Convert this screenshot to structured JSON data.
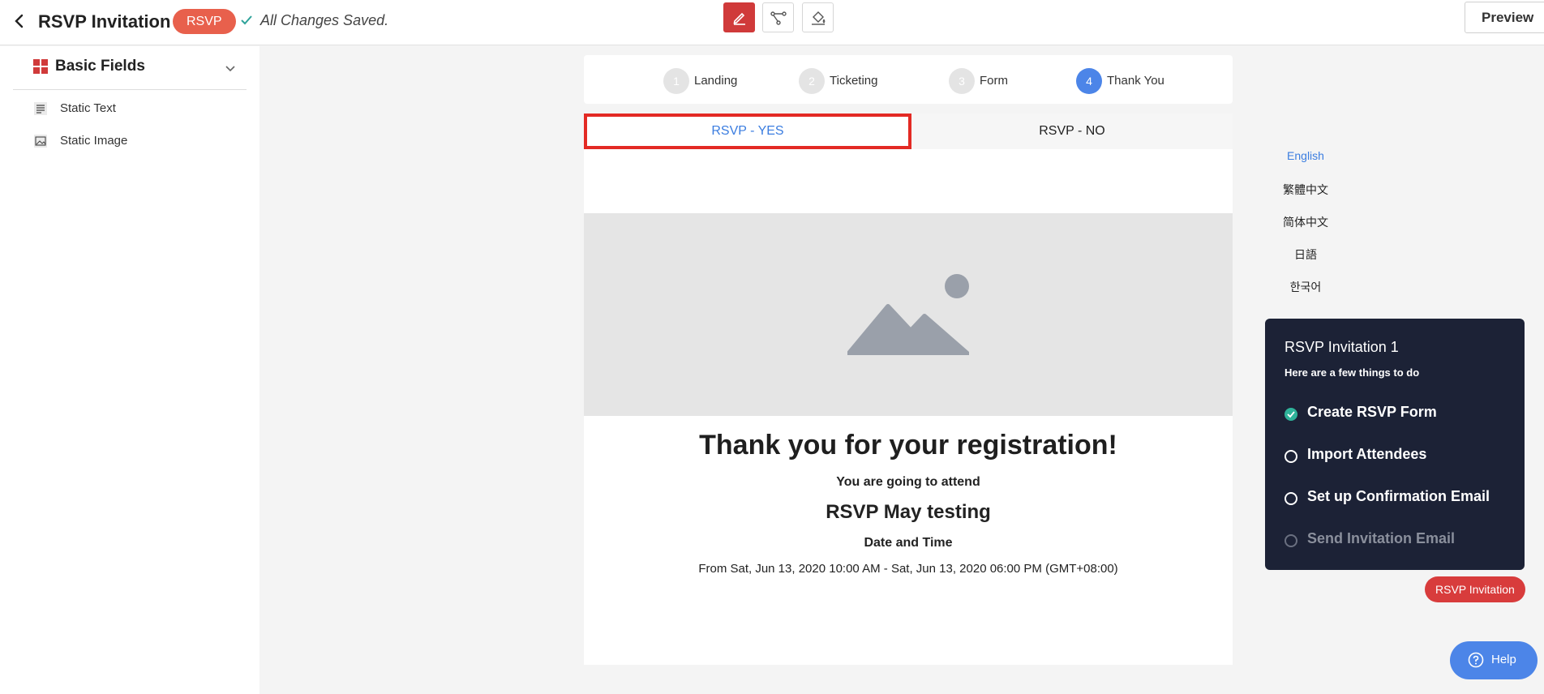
{
  "header": {
    "title": "RSVP Invitation 1",
    "badge": "RSVP",
    "saved_status": "All Changes Saved.",
    "preview_label": "Preview"
  },
  "sidebar": {
    "section_title": "Basic Fields",
    "items": [
      {
        "label": "Static Text",
        "icon": "text-lines-icon"
      },
      {
        "label": "Static Image",
        "icon": "image-icon"
      }
    ]
  },
  "steps": [
    {
      "num": "1",
      "label": "Landing"
    },
    {
      "num": "2",
      "label": "Ticketing"
    },
    {
      "num": "3",
      "label": "Form"
    },
    {
      "num": "4",
      "label": "Thank You"
    }
  ],
  "tabs": {
    "yes": "RSVP - YES",
    "no": "RSVP - NO"
  },
  "thankyou": {
    "title": "Thank you for your registration!",
    "subtitle": "You are going to attend",
    "event_name": "RSVP May testing",
    "datetime_label": "Date and Time",
    "datetime": "From Sat, Jun 13, 2020 10:00 AM - Sat, Jun 13, 2020 06:00 PM (GMT+08:00)"
  },
  "languages": [
    "English",
    "繁體中文",
    "简体中文",
    "日語",
    "한국어"
  ],
  "checklist": {
    "title": "RSVP Invitation 1",
    "subtitle": "Here are a few things to do",
    "items": [
      {
        "label": "Create RSVP Form",
        "state": "done"
      },
      {
        "label": "Import Attendees",
        "state": "todo"
      },
      {
        "label": "Set up Confirmation Email",
        "state": "todo"
      },
      {
        "label": "Send Invitation Email",
        "state": "disabled"
      }
    ]
  },
  "floating": {
    "rsvp_button": "RSVP Invitation",
    "help_label": "Help"
  },
  "colors": {
    "accent_red": "#d03a3a",
    "accent_blue": "#4c85e8",
    "panel_bg": "#1c2236",
    "done_green": "#2fb39a"
  }
}
